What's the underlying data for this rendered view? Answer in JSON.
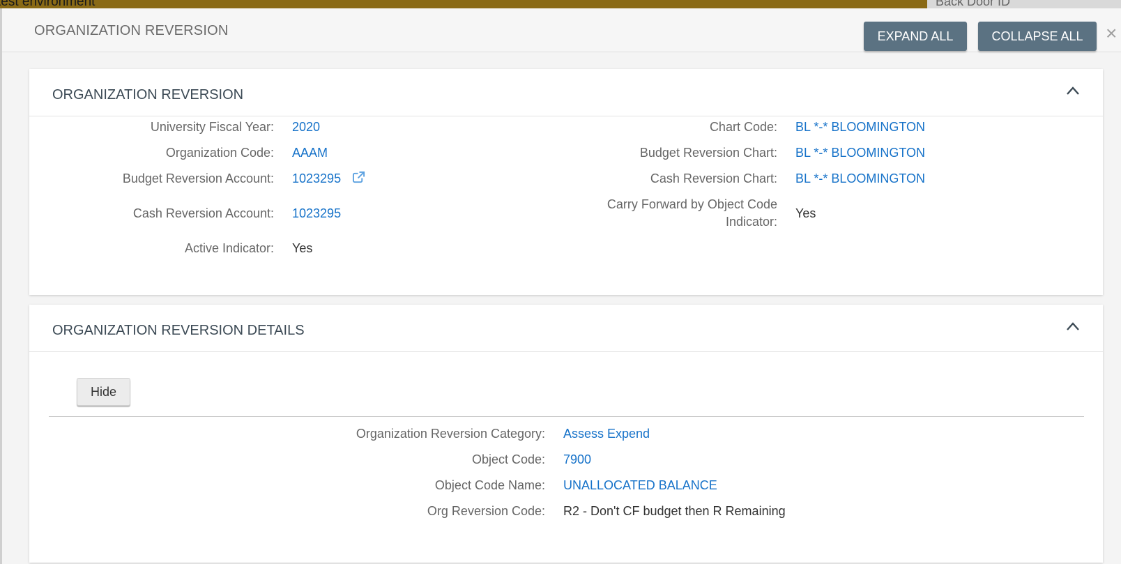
{
  "background": {
    "banner_text": "test environment",
    "backdoor_label": "Back Door ID"
  },
  "modal": {
    "title": "ORGANIZATION REVERSION",
    "expand_all": "EXPAND ALL",
    "collapse_all": "COLLAPSE ALL",
    "close": "×"
  },
  "section1": {
    "title": "ORGANIZATION REVERSION",
    "fields": {
      "fiscal_year_label": "University Fiscal Year:",
      "fiscal_year_value": "2020",
      "org_code_label": "Organization Code:",
      "org_code_value": "AAAM",
      "budget_acct_label": "Budget Reversion Account:",
      "budget_acct_value": "1023295",
      "cash_acct_label": "Cash Reversion Account:",
      "cash_acct_value": "1023295",
      "active_label": "Active Indicator:",
      "active_value": "Yes",
      "chart_label": "Chart Code:",
      "chart_value": "BL *-* BLOOMINGTON",
      "budget_chart_label": "Budget Reversion Chart:",
      "budget_chart_value": "BL *-* BLOOMINGTON",
      "cash_chart_label": "Cash Reversion Chart:",
      "cash_chart_value": "BL *-* BLOOMINGTON",
      "carry_fwd_label_1": "Carry Forward by Object Code",
      "carry_fwd_label_2": "Indicator:",
      "carry_fwd_value": "Yes"
    }
  },
  "section2": {
    "title": "ORGANIZATION REVERSION DETAILS",
    "hide_button": "Hide",
    "fields": {
      "category_label": "Organization Reversion Category:",
      "category_value": "Assess Expend",
      "object_code_label": "Object Code:",
      "object_code_value": "7900",
      "object_name_label": "Object Code Name:",
      "object_name_value": "UNALLOCATED BALANCE",
      "reversion_code_label": "Org Reversion Code:",
      "reversion_code_value": "R2 - Don't CF budget then R Remaining"
    }
  },
  "icons": {
    "external_link": "external-link-icon",
    "chevron_up": "chevron-up-icon",
    "close": "close-icon"
  },
  "colors": {
    "link": "#1672c9",
    "header_button": "#5b7282",
    "banner": "#8a6a16"
  }
}
